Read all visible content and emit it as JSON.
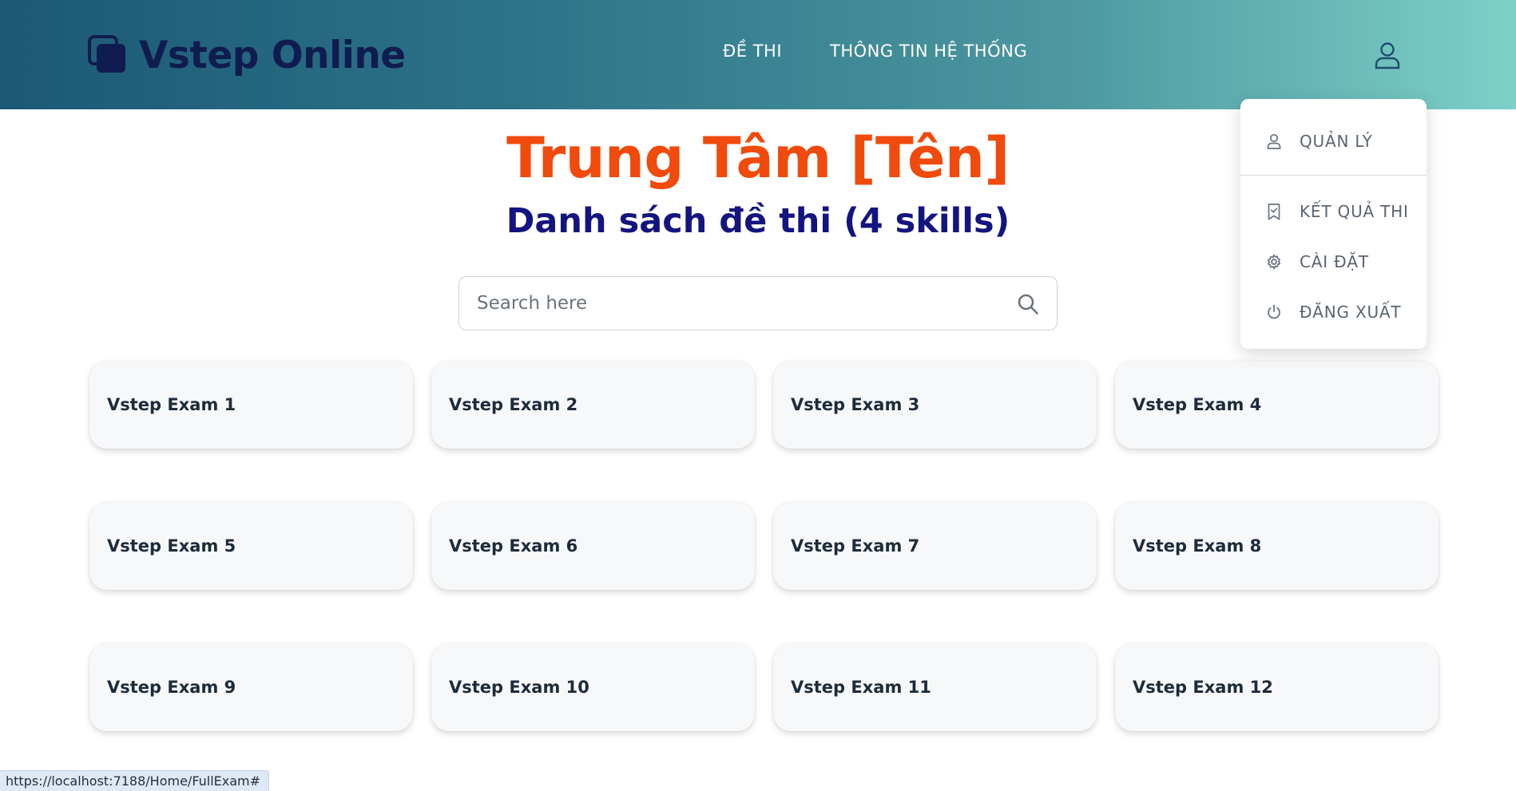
{
  "header": {
    "logo_text": "Vstep Online",
    "logo_icon": "stacked-squares-icon",
    "nav": [
      {
        "label": "ĐỀ THI"
      },
      {
        "label": "THÔNG TIN HỆ THỐNG"
      }
    ],
    "user_icon": "user-icon"
  },
  "main": {
    "center_title": "Trung Tâm [Tên]",
    "list_title": "Danh sách đề thi (4 skills)",
    "search": {
      "placeholder": "Search here",
      "value": "",
      "icon": "search-icon"
    },
    "exams": [
      {
        "label": "Vstep Exam 1"
      },
      {
        "label": "Vstep Exam 2"
      },
      {
        "label": "Vstep Exam 3"
      },
      {
        "label": "Vstep Exam 4"
      },
      {
        "label": "Vstep Exam 5"
      },
      {
        "label": "Vstep Exam 6"
      },
      {
        "label": "Vstep Exam 7"
      },
      {
        "label": "Vstep Exam 8"
      },
      {
        "label": "Vstep Exam 9"
      },
      {
        "label": "Vstep Exam 10"
      },
      {
        "label": "Vstep Exam 11"
      },
      {
        "label": "Vstep Exam 12"
      }
    ]
  },
  "user_menu": {
    "items": [
      {
        "label": "QUẢN LÝ",
        "icon": "user-icon"
      },
      {
        "label": "KẾT QUẢ THI",
        "icon": "bookmark-check-icon"
      },
      {
        "label": "CÀI ĐẶT",
        "icon": "gear-icon"
      },
      {
        "label": "ĐĂNG XUẤT",
        "icon": "power-icon"
      }
    ]
  },
  "status_bar": {
    "url": "https://localhost:7188/Home/FullExam#"
  },
  "colors": {
    "header_gradient_start": "#1c5876",
    "header_gradient_end": "#7dd1c8",
    "logo_text": "#101c4f",
    "center_title": "#f04a0c",
    "list_title": "#141480"
  }
}
